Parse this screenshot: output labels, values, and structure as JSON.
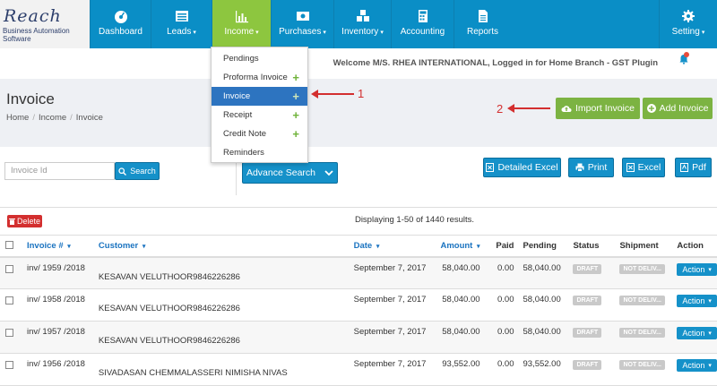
{
  "logo": {
    "main": "Reach",
    "sub": "Business Automation Software"
  },
  "nav": {
    "items": [
      {
        "label": "Dashboard",
        "icon": "dashboard-icon",
        "caret": ""
      },
      {
        "label": "Leads",
        "icon": "list-icon",
        "caret": "▾"
      },
      {
        "label": "Income",
        "icon": "bar-chart-icon",
        "caret": "▾"
      },
      {
        "label": "Purchases",
        "icon": "money-icon",
        "caret": "▾"
      },
      {
        "label": "Inventory",
        "icon": "cubes-icon",
        "caret": "▾"
      },
      {
        "label": "Accounting",
        "icon": "calculator-icon",
        "caret": ""
      },
      {
        "label": "Reports",
        "icon": "file-icon",
        "caret": ""
      },
      {
        "label": "Setting",
        "icon": "gear-icon",
        "caret": "▾"
      }
    ]
  },
  "income_menu": {
    "items": [
      {
        "label": "Pendings",
        "plus": ""
      },
      {
        "label": "Proforma Invoice",
        "plus": "+"
      },
      {
        "label": "Invoice",
        "plus": "+"
      },
      {
        "label": "Receipt",
        "plus": "+"
      },
      {
        "label": "Credit Note",
        "plus": "+"
      },
      {
        "label": "Reminders",
        "plus": ""
      }
    ]
  },
  "welcome": "Welcome M/S. RHEA INTERNATIONAL, Logged in for Home Branch - GST Plugin",
  "page": {
    "title": "Invoice",
    "breadcrumb": [
      "Home",
      "Income",
      "Invoice"
    ]
  },
  "annotations": {
    "arrow1": "1",
    "arrow2": "2"
  },
  "buttons": {
    "import_invoice": "Import Invoice",
    "add_invoice": "Add Invoice",
    "search": "Search",
    "advance_search": "Advance Search",
    "detailed_excel": "Detailed Excel",
    "print": "Print",
    "excel": "Excel",
    "pdf": "Pdf",
    "delete": "Delete"
  },
  "search": {
    "placeholder": "Invoice Id"
  },
  "table": {
    "summary": "Displaying 1-50 of 1440 results.",
    "columns": [
      "Invoice #",
      "Customer",
      "Date",
      "Amount",
      "Paid",
      "Pending",
      "Status",
      "Shipment",
      "Action"
    ],
    "rows": [
      {
        "invoice": "inv/ 1959 /2018",
        "customer": "KESAVAN VELUTHOOR9846226286",
        "date": "September 7, 2017",
        "amount": "58,040.00",
        "paid": "0.00",
        "pending": "58,040.00",
        "status": "DRAFT",
        "shipment": "NOT DELIV...",
        "action": "Action"
      },
      {
        "invoice": "inv/ 1958 /2018",
        "customer": "KESAVAN VELUTHOOR9846226286",
        "date": "September 7, 2017",
        "amount": "58,040.00",
        "paid": "0.00",
        "pending": "58,040.00",
        "status": "DRAFT",
        "shipment": "NOT DELIV...",
        "action": "Action"
      },
      {
        "invoice": "inv/ 1957 /2018",
        "customer": "KESAVAN VELUTHOOR9846226286",
        "date": "September 7, 2017",
        "amount": "58,040.00",
        "paid": "0.00",
        "pending": "58,040.00",
        "status": "DRAFT",
        "shipment": "NOT DELIV...",
        "action": "Action"
      },
      {
        "invoice": "inv/ 1956 /2018",
        "customer": "SIVADASAN CHEMMALASSERI NIMISHA NIVAS",
        "date": "September 7, 2017",
        "amount": "93,552.00",
        "paid": "0.00",
        "pending": "93,552.00",
        "status": "DRAFT",
        "shipment": "NOT DELIV...",
        "action": "Action"
      }
    ]
  },
  "colors": {
    "nav_bg": "#0a8ec6",
    "nav_active": "#8dc63f",
    "accent_blue": "#1591c9",
    "danger": "#d32f2f",
    "success": "#7cb342"
  }
}
